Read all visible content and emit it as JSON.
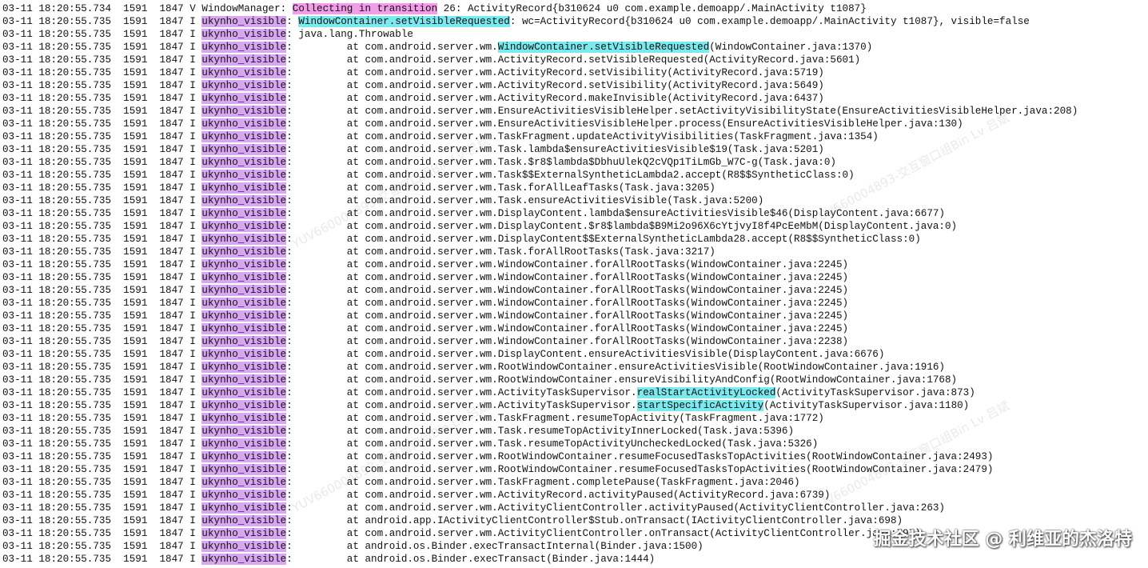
{
  "lines": [
    {
      "head": "03-11 18:20:55.734  1591  1847 V ",
      "tag": "WindowManager",
      "tag_hl": "",
      "sep": ": ",
      "segs": [
        {
          "t": "Collecting in transition",
          "hl": "pink"
        },
        {
          "t": " 26: ActivityRecord{b310624 u0 com.example.demoapp/.MainActivity t1087}",
          "hl": ""
        }
      ]
    },
    {
      "head": "03-11 18:20:55.735  1591  1847 I ",
      "tag": "ukynho_visible",
      "tag_hl": "purple",
      "sep": ": ",
      "segs": [
        {
          "t": "WindowContainer.setVisibleRequested",
          "hl": "cyan"
        },
        {
          "t": ": wc=ActivityRecord{b310624 u0 com.example.demoapp/.MainActivity t1087}, visible=false",
          "hl": ""
        }
      ]
    },
    {
      "head": "03-11 18:20:55.735  1591  1847 I ",
      "tag": "ukynho_visible",
      "tag_hl": "purple",
      "sep": ": ",
      "segs": [
        {
          "t": "java.lang.Throwable",
          "hl": ""
        }
      ]
    },
    {
      "head": "03-11 18:20:55.735  1591  1847 I ",
      "tag": "ukynho_visible",
      "tag_hl": "purple",
      "sep": ":         ",
      "segs": [
        {
          "t": "at com.android.server.wm.",
          "hl": ""
        },
        {
          "t": "WindowContainer.setVisibleRequested",
          "hl": "cyan"
        },
        {
          "t": "(WindowContainer.java:1370)",
          "hl": ""
        }
      ]
    },
    {
      "head": "03-11 18:20:55.735  1591  1847 I ",
      "tag": "ukynho_visible",
      "tag_hl": "purple",
      "sep": ":         ",
      "segs": [
        {
          "t": "at com.android.server.wm.ActivityRecord.setVisibleRequested(ActivityRecord.java:5601)",
          "hl": ""
        }
      ]
    },
    {
      "head": "03-11 18:20:55.735  1591  1847 I ",
      "tag": "ukynho_visible",
      "tag_hl": "purple",
      "sep": ":         ",
      "segs": [
        {
          "t": "at com.android.server.wm.ActivityRecord.setVisibility(ActivityRecord.java:5719)",
          "hl": ""
        }
      ]
    },
    {
      "head": "03-11 18:20:55.735  1591  1847 I ",
      "tag": "ukynho_visible",
      "tag_hl": "purple",
      "sep": ":         ",
      "segs": [
        {
          "t": "at com.android.server.wm.ActivityRecord.setVisibility(ActivityRecord.java:5649)",
          "hl": ""
        }
      ]
    },
    {
      "head": "03-11 18:20:55.735  1591  1847 I ",
      "tag": "ukynho_visible",
      "tag_hl": "purple",
      "sep": ":         ",
      "segs": [
        {
          "t": "at com.android.server.wm.ActivityRecord.makeInvisible(ActivityRecord.java:6437)",
          "hl": ""
        }
      ]
    },
    {
      "head": "03-11 18:20:55.735  1591  1847 I ",
      "tag": "ukynho_visible",
      "tag_hl": "purple",
      "sep": ":         ",
      "segs": [
        {
          "t": "at com.android.server.wm.EnsureActivitiesVisibleHelper.setActivityVisibilityState(EnsureActivitiesVisibleHelper.java:208)",
          "hl": ""
        }
      ]
    },
    {
      "head": "03-11 18:20:55.735  1591  1847 I ",
      "tag": "ukynho_visible",
      "tag_hl": "purple",
      "sep": ":         ",
      "segs": [
        {
          "t": "at com.android.server.wm.EnsureActivitiesVisibleHelper.process(EnsureActivitiesVisibleHelper.java:130)",
          "hl": ""
        }
      ]
    },
    {
      "head": "03-11 18:20:55.735  1591  1847 I ",
      "tag": "ukynho_visible",
      "tag_hl": "purple",
      "sep": ":         ",
      "segs": [
        {
          "t": "at com.android.server.wm.TaskFragment.updateActivityVisibilities(TaskFragment.java:1354)",
          "hl": ""
        }
      ]
    },
    {
      "head": "03-11 18:20:55.735  1591  1847 I ",
      "tag": "ukynho_visible",
      "tag_hl": "purple",
      "sep": ":         ",
      "segs": [
        {
          "t": "at com.android.server.wm.Task.lambda$ensureActivitiesVisible$19(Task.java:5201)",
          "hl": ""
        }
      ]
    },
    {
      "head": "03-11 18:20:55.735  1591  1847 I ",
      "tag": "ukynho_visible",
      "tag_hl": "purple",
      "sep": ":         ",
      "segs": [
        {
          "t": "at com.android.server.wm.Task.$r8$lambda$DbhuUlekQ2cVQp1TiLmGb_W7C-g(Task.java:0)",
          "hl": ""
        }
      ]
    },
    {
      "head": "03-11 18:20:55.735  1591  1847 I ",
      "tag": "ukynho_visible",
      "tag_hl": "purple",
      "sep": ":         ",
      "segs": [
        {
          "t": "at com.android.server.wm.Task$$ExternalSyntheticLambda2.accept(R8$$SyntheticClass:0)",
          "hl": ""
        }
      ]
    },
    {
      "head": "03-11 18:20:55.735  1591  1847 I ",
      "tag": "ukynho_visible",
      "tag_hl": "purple",
      "sep": ":         ",
      "segs": [
        {
          "t": "at com.android.server.wm.Task.forAllLeafTasks(Task.java:3205)",
          "hl": ""
        }
      ]
    },
    {
      "head": "03-11 18:20:55.735  1591  1847 I ",
      "tag": "ukynho_visible",
      "tag_hl": "purple",
      "sep": ":         ",
      "segs": [
        {
          "t": "at com.android.server.wm.Task.ensureActivitiesVisible(Task.java:5200)",
          "hl": ""
        }
      ]
    },
    {
      "head": "03-11 18:20:55.735  1591  1847 I ",
      "tag": "ukynho_visible",
      "tag_hl": "purple",
      "sep": ":         ",
      "segs": [
        {
          "t": "at com.android.server.wm.DisplayContent.lambda$ensureActivitiesVisible$46(DisplayContent.java:6677)",
          "hl": ""
        }
      ]
    },
    {
      "head": "03-11 18:20:55.735  1591  1847 I ",
      "tag": "ukynho_visible",
      "tag_hl": "purple",
      "sep": ":         ",
      "segs": [
        {
          "t": "at com.android.server.wm.DisplayContent.$r8$lambda$B9Mi2o96X6cYtjvyI8f4PcEeMbM(DisplayContent.java:0)",
          "hl": ""
        }
      ]
    },
    {
      "head": "03-11 18:20:55.735  1591  1847 I ",
      "tag": "ukynho_visible",
      "tag_hl": "purple",
      "sep": ":         ",
      "segs": [
        {
          "t": "at com.android.server.wm.DisplayContent$$ExternalSyntheticLambda28.accept(R8$$SyntheticClass:0)",
          "hl": ""
        }
      ]
    },
    {
      "head": "03-11 18:20:55.735  1591  1847 I ",
      "tag": "ukynho_visible",
      "tag_hl": "purple",
      "sep": ":         ",
      "segs": [
        {
          "t": "at com.android.server.wm.Task.forAllRootTasks(Task.java:3217)",
          "hl": ""
        }
      ]
    },
    {
      "head": "03-11 18:20:55.735  1591  1847 I ",
      "tag": "ukynho_visible",
      "tag_hl": "purple",
      "sep": ":         ",
      "segs": [
        {
          "t": "at com.android.server.wm.WindowContainer.forAllRootTasks(WindowContainer.java:2245)",
          "hl": ""
        }
      ]
    },
    {
      "head": "03-11 18:20:55.735  1591  1847 I ",
      "tag": "ukynho_visible",
      "tag_hl": "purple",
      "sep": ":         ",
      "segs": [
        {
          "t": "at com.android.server.wm.WindowContainer.forAllRootTasks(WindowContainer.java:2245)",
          "hl": ""
        }
      ]
    },
    {
      "head": "03-11 18:20:55.735  1591  1847 I ",
      "tag": "ukynho_visible",
      "tag_hl": "purple",
      "sep": ":         ",
      "segs": [
        {
          "t": "at com.android.server.wm.WindowContainer.forAllRootTasks(WindowContainer.java:2245)",
          "hl": ""
        }
      ]
    },
    {
      "head": "03-11 18:20:55.735  1591  1847 I ",
      "tag": "ukynho_visible",
      "tag_hl": "purple",
      "sep": ":         ",
      "segs": [
        {
          "t": "at com.android.server.wm.WindowContainer.forAllRootTasks(WindowContainer.java:2245)",
          "hl": ""
        }
      ]
    },
    {
      "head": "03-11 18:20:55.735  1591  1847 I ",
      "tag": "ukynho_visible",
      "tag_hl": "purple",
      "sep": ":         ",
      "segs": [
        {
          "t": "at com.android.server.wm.WindowContainer.forAllRootTasks(WindowContainer.java:2245)",
          "hl": ""
        }
      ]
    },
    {
      "head": "03-11 18:20:55.735  1591  1847 I ",
      "tag": "ukynho_visible",
      "tag_hl": "purple",
      "sep": ":         ",
      "segs": [
        {
          "t": "at com.android.server.wm.WindowContainer.forAllRootTasks(WindowContainer.java:2245)",
          "hl": ""
        }
      ]
    },
    {
      "head": "03-11 18:20:55.735  1591  1847 I ",
      "tag": "ukynho_visible",
      "tag_hl": "purple",
      "sep": ":         ",
      "segs": [
        {
          "t": "at com.android.server.wm.WindowContainer.forAllRootTasks(WindowContainer.java:2238)",
          "hl": ""
        }
      ]
    },
    {
      "head": "03-11 18:20:55.735  1591  1847 I ",
      "tag": "ukynho_visible",
      "tag_hl": "purple",
      "sep": ":         ",
      "segs": [
        {
          "t": "at com.android.server.wm.DisplayContent.ensureActivitiesVisible(DisplayContent.java:6676)",
          "hl": ""
        }
      ]
    },
    {
      "head": "03-11 18:20:55.735  1591  1847 I ",
      "tag": "ukynho_visible",
      "tag_hl": "purple",
      "sep": ":         ",
      "segs": [
        {
          "t": "at com.android.server.wm.RootWindowContainer.ensureActivitiesVisible(RootWindowContainer.java:1916)",
          "hl": ""
        }
      ]
    },
    {
      "head": "03-11 18:20:55.735  1591  1847 I ",
      "tag": "ukynho_visible",
      "tag_hl": "purple",
      "sep": ":         ",
      "segs": [
        {
          "t": "at com.android.server.wm.RootWindowContainer.ensureVisibilityAndConfig(RootWindowContainer.java:1768)",
          "hl": ""
        }
      ]
    },
    {
      "head": "03-11 18:20:55.735  1591  1847 I ",
      "tag": "ukynho_visible",
      "tag_hl": "purple",
      "sep": ":         ",
      "segs": [
        {
          "t": "at com.android.server.wm.ActivityTaskSupervisor.",
          "hl": ""
        },
        {
          "t": "realStartActivityLocked",
          "hl": "cyan"
        },
        {
          "t": "(ActivityTaskSupervisor.java:873)",
          "hl": ""
        }
      ]
    },
    {
      "head": "03-11 18:20:55.735  1591  1847 I ",
      "tag": "ukynho_visible",
      "tag_hl": "purple",
      "sep": ":         ",
      "segs": [
        {
          "t": "at com.android.server.wm.ActivityTaskSupervisor.",
          "hl": ""
        },
        {
          "t": "startSpecificActivity",
          "hl": "cyan"
        },
        {
          "t": "(ActivityTaskSupervisor.java:1180)",
          "hl": ""
        }
      ]
    },
    {
      "head": "03-11 18:20:55.735  1591  1847 I ",
      "tag": "ukynho_visible",
      "tag_hl": "purple",
      "sep": ":         ",
      "segs": [
        {
          "t": "at com.android.server.wm.TaskFragment.resumeTopActivity(TaskFragment.java:1772)",
          "hl": ""
        }
      ]
    },
    {
      "head": "03-11 18:20:55.735  1591  1847 I ",
      "tag": "ukynho_visible",
      "tag_hl": "purple",
      "sep": ":         ",
      "segs": [
        {
          "t": "at com.android.server.wm.Task.resumeTopActivityInnerLocked(Task.java:5396)",
          "hl": ""
        }
      ]
    },
    {
      "head": "03-11 18:20:55.735  1591  1847 I ",
      "tag": "ukynho_visible",
      "tag_hl": "purple",
      "sep": ":         ",
      "segs": [
        {
          "t": "at com.android.server.wm.Task.resumeTopActivityUncheckedLocked(Task.java:5326)",
          "hl": ""
        }
      ]
    },
    {
      "head": "03-11 18:20:55.735  1591  1847 I ",
      "tag": "ukynho_visible",
      "tag_hl": "purple",
      "sep": ":         ",
      "segs": [
        {
          "t": "at com.android.server.wm.RootWindowContainer.resumeFocusedTasksTopActivities(RootWindowContainer.java:2493)",
          "hl": ""
        }
      ]
    },
    {
      "head": "03-11 18:20:55.735  1591  1847 I ",
      "tag": "ukynho_visible",
      "tag_hl": "purple",
      "sep": ":         ",
      "segs": [
        {
          "t": "at com.android.server.wm.RootWindowContainer.resumeFocusedTasksTopActivities(RootWindowContainer.java:2479)",
          "hl": ""
        }
      ]
    },
    {
      "head": "03-11 18:20:55.735  1591  1847 I ",
      "tag": "ukynho_visible",
      "tag_hl": "purple",
      "sep": ":         ",
      "segs": [
        {
          "t": "at com.android.server.wm.TaskFragment.completePause(TaskFragment.java:2046)",
          "hl": ""
        }
      ]
    },
    {
      "head": "03-11 18:20:55.735  1591  1847 I ",
      "tag": "ukynho_visible",
      "tag_hl": "purple",
      "sep": ":         ",
      "segs": [
        {
          "t": "at com.android.server.wm.ActivityRecord.activityPaused(ActivityRecord.java:6739)",
          "hl": ""
        }
      ]
    },
    {
      "head": "03-11 18:20:55.735  1591  1847 I ",
      "tag": "ukynho_visible",
      "tag_hl": "purple",
      "sep": ":         ",
      "segs": [
        {
          "t": "at com.android.server.wm.ActivityClientController.activityPaused(ActivityClientController.java:263)",
          "hl": ""
        }
      ]
    },
    {
      "head": "03-11 18:20:55.735  1591  1847 I ",
      "tag": "ukynho_visible",
      "tag_hl": "purple",
      "sep": ":         ",
      "segs": [
        {
          "t": "at android.app.IActivityClientController$Stub.onTransact(IActivityClientController.java:698)",
          "hl": ""
        }
      ]
    },
    {
      "head": "03-11 18:20:55.735  1591  1847 I ",
      "tag": "ukynho_visible",
      "tag_hl": "purple",
      "sep": ":         ",
      "segs": [
        {
          "t": "at com.android.server.wm.ActivityClientController.onTransact(ActivityClientController.java:797)",
          "hl": ""
        }
      ]
    },
    {
      "head": "03-11 18:20:55.735  1591  1847 I ",
      "tag": "ukynho_visible",
      "tag_hl": "purple",
      "sep": ":         ",
      "segs": [
        {
          "t": "at android.os.Binder.execTransactInternal(Binder.java:1500)",
          "hl": ""
        }
      ]
    },
    {
      "head": "03-11 18:20:55.735  1591  1847 I ",
      "tag": "ukynho_visible",
      "tag_hl": "purple",
      "sep": ":         ",
      "segs": [
        {
          "t": "at android.os.Binder.execTransact(Binder.java:1444)",
          "hl": ""
        }
      ]
    }
  ],
  "watermark_text": "YUV660004893-交互窗口组Bin Lv 吕斌",
  "credit": "掘金技术社区 @ 利维亚的杰洛特",
  "colors": {
    "tag_highlight": "#d9a6f0",
    "pink_highlight": "#f09ee8",
    "cyan_highlight": "#7de8ee"
  }
}
